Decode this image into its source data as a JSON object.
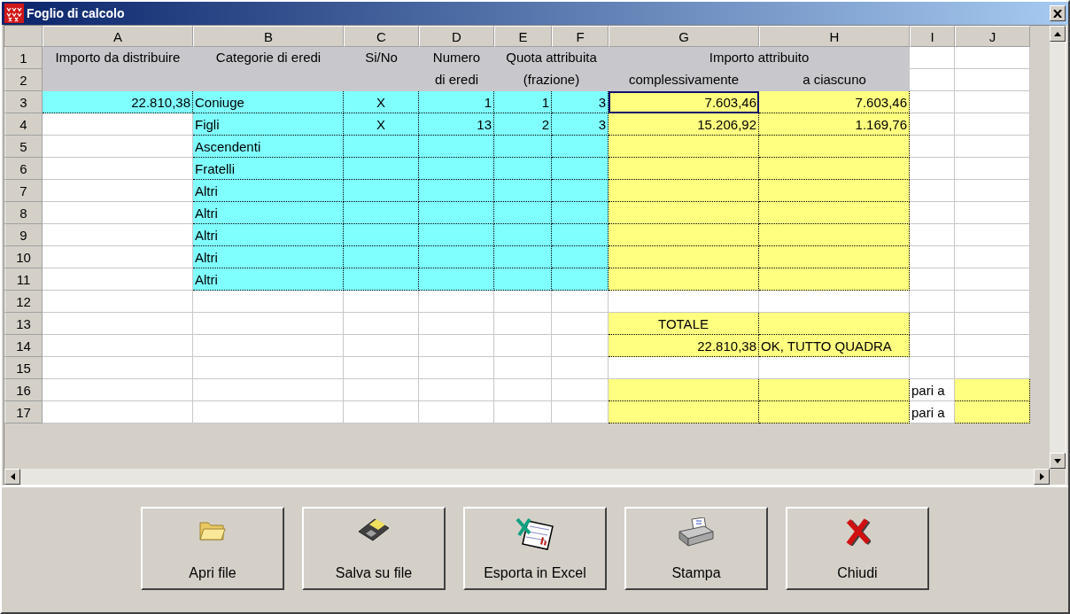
{
  "window": {
    "title": "Foglio di calcolo"
  },
  "sheet": {
    "columns": [
      "A",
      "B",
      "C",
      "D",
      "E",
      "F",
      "G",
      "H",
      "I",
      "J"
    ],
    "rows": [
      {
        "number": "1",
        "cells": [
          {
            "text": "Importo da distribuire",
            "kind": "header",
            "selected": false
          },
          {
            "text": "Categorie di eredi",
            "kind": "header",
            "selected": false
          },
          {
            "text": "Si/No",
            "kind": "header",
            "selected": false
          },
          {
            "text": "Numero",
            "kind": "header",
            "selected": false
          },
          {
            "text": "Quota attribuita",
            "kind": "header",
            "merged": true,
            "selected": false
          },
          {
            "text": "Importo attribuito",
            "kind": "header",
            "merged": true,
            "selected": false
          },
          {
            "kind": "plain",
            "selected": false
          },
          {
            "kind": "plain",
            "selected": false
          }
        ]
      },
      {
        "number": "2",
        "cells": [
          {
            "kind": "header",
            "selected": false
          },
          {
            "kind": "header",
            "selected": false
          },
          {
            "kind": "header",
            "selected": false
          },
          {
            "text": "di eredi",
            "kind": "header",
            "selected": false
          },
          {
            "text": "(frazione)",
            "kind": "header",
            "merged": true,
            "selected": false
          },
          {
            "text": "complessivamente",
            "kind": "header",
            "selected": false
          },
          {
            "text": "a ciascuno",
            "kind": "header",
            "selected": false
          },
          {
            "kind": "plain",
            "selected": false
          },
          {
            "kind": "plain",
            "selected": false
          }
        ]
      },
      {
        "number": "3",
        "cells": [
          {
            "text": "22.810,38",
            "kind": "input-number",
            "selected": false
          },
          {
            "text": "Coniuge",
            "kind": "input-text",
            "selected": false
          },
          {
            "text": "X",
            "kind": "input-mark",
            "selected": false
          },
          {
            "text": "1",
            "kind": "input-number",
            "selected": false
          },
          {
            "text": "1",
            "kind": "input-number",
            "selected": false
          },
          {
            "text": "3",
            "kind": "input-number",
            "selected": false
          },
          {
            "text": "7.603,46",
            "kind": "output-number",
            "selected": true
          },
          {
            "text": "7.603,46",
            "kind": "output-number",
            "selected": false
          },
          {
            "kind": "plain",
            "selected": false
          },
          {
            "kind": "plain",
            "selected": false
          }
        ]
      },
      {
        "number": "4",
        "cells": [
          {
            "kind": "plain",
            "selected": false
          },
          {
            "text": "Figli",
            "kind": "input-text",
            "selected": false
          },
          {
            "text": "X",
            "kind": "input-mark",
            "selected": false
          },
          {
            "text": "13",
            "kind": "input-number",
            "selected": false
          },
          {
            "text": "2",
            "kind": "input-number",
            "selected": false
          },
          {
            "text": "3",
            "kind": "input-number",
            "selected": false
          },
          {
            "text": "15.206,92",
            "kind": "output-number",
            "selected": false
          },
          {
            "text": "1.169,76",
            "kind": "output-number",
            "selected": false
          },
          {
            "kind": "plain",
            "selected": false
          },
          {
            "kind": "plain",
            "selected": false
          }
        ]
      },
      {
        "number": "5",
        "cells": [
          {
            "kind": "plain",
            "selected": false
          },
          {
            "text": "Ascendenti",
            "kind": "input-text",
            "selected": false
          },
          {
            "kind": "input",
            "selected": false
          },
          {
            "kind": "input",
            "selected": false
          },
          {
            "kind": "input",
            "selected": false
          },
          {
            "kind": "input",
            "selected": false
          },
          {
            "kind": "output",
            "selected": false
          },
          {
            "kind": "output",
            "selected": false
          },
          {
            "kind": "plain",
            "selected": false
          },
          {
            "kind": "plain",
            "selected": false
          }
        ]
      },
      {
        "number": "6",
        "cells": [
          {
            "kind": "plain",
            "selected": false
          },
          {
            "text": "Fratelli",
            "kind": "input-text",
            "selected": false
          },
          {
            "kind": "input",
            "selected": false
          },
          {
            "kind": "input",
            "selected": false
          },
          {
            "kind": "input",
            "selected": false
          },
          {
            "kind": "input",
            "selected": false
          },
          {
            "kind": "output",
            "selected": false
          },
          {
            "kind": "output",
            "selected": false
          },
          {
            "kind": "plain",
            "selected": false
          },
          {
            "kind": "plain",
            "selected": false
          }
        ]
      },
      {
        "number": "7",
        "cells": [
          {
            "kind": "plain",
            "selected": false
          },
          {
            "text": "Altri",
            "kind": "input-text",
            "selected": false
          },
          {
            "kind": "input",
            "selected": false
          },
          {
            "kind": "input",
            "selected": false
          },
          {
            "kind": "input",
            "selected": false
          },
          {
            "kind": "input",
            "selected": false
          },
          {
            "kind": "output",
            "selected": false
          },
          {
            "kind": "output",
            "selected": false
          },
          {
            "kind": "plain",
            "selected": false
          },
          {
            "kind": "plain",
            "selected": false
          }
        ]
      },
      {
        "number": "8",
        "cells": [
          {
            "kind": "plain",
            "selected": false
          },
          {
            "text": "Altri",
            "kind": "input-text",
            "selected": false
          },
          {
            "kind": "input",
            "selected": false
          },
          {
            "kind": "input",
            "selected": false
          },
          {
            "kind": "input",
            "selected": false
          },
          {
            "kind": "input",
            "selected": false
          },
          {
            "kind": "output",
            "selected": false
          },
          {
            "kind": "output",
            "selected": false
          },
          {
            "kind": "plain",
            "selected": false
          },
          {
            "kind": "plain",
            "selected": false
          }
        ]
      },
      {
        "number": "9",
        "cells": [
          {
            "kind": "plain",
            "selected": false
          },
          {
            "text": "Altri",
            "kind": "input-text",
            "selected": false
          },
          {
            "kind": "input",
            "selected": false
          },
          {
            "kind": "input",
            "selected": false
          },
          {
            "kind": "input",
            "selected": false
          },
          {
            "kind": "input",
            "selected": false
          },
          {
            "kind": "output",
            "selected": false
          },
          {
            "kind": "output",
            "selected": false
          },
          {
            "kind": "plain",
            "selected": false
          },
          {
            "kind": "plain",
            "selected": false
          }
        ]
      },
      {
        "number": "10",
        "cells": [
          {
            "kind": "plain",
            "selected": false
          },
          {
            "text": "Altri",
            "kind": "input-text",
            "selected": false
          },
          {
            "kind": "input",
            "selected": false
          },
          {
            "kind": "input",
            "selected": false
          },
          {
            "kind": "input",
            "selected": false
          },
          {
            "kind": "input",
            "selected": false
          },
          {
            "kind": "output",
            "selected": false
          },
          {
            "kind": "output",
            "selected": false
          },
          {
            "kind": "plain",
            "selected": false
          },
          {
            "kind": "plain",
            "selected": false
          }
        ]
      },
      {
        "number": "11",
        "cells": [
          {
            "kind": "plain",
            "selected": false
          },
          {
            "text": "Altri",
            "kind": "input-text",
            "selected": false
          },
          {
            "kind": "input",
            "selected": false
          },
          {
            "kind": "input",
            "selected": false
          },
          {
            "kind": "input",
            "selected": false
          },
          {
            "kind": "input",
            "selected": false
          },
          {
            "kind": "output",
            "selected": false
          },
          {
            "kind": "output",
            "selected": false
          },
          {
            "kind": "plain",
            "selected": false
          },
          {
            "kind": "plain",
            "selected": false
          }
        ]
      },
      {
        "number": "12",
        "cells": [
          {
            "kind": "plain",
            "selected": false
          },
          {
            "kind": "plain",
            "selected": false
          },
          {
            "kind": "plain",
            "selected": false
          },
          {
            "kind": "plain",
            "selected": false
          },
          {
            "kind": "plain",
            "selected": false
          },
          {
            "kind": "plain",
            "selected": false
          },
          {
            "kind": "plain",
            "selected": false
          },
          {
            "kind": "plain",
            "selected": false
          },
          {
            "kind": "plain",
            "selected": false
          },
          {
            "kind": "plain",
            "selected": false
          }
        ]
      },
      {
        "number": "13",
        "cells": [
          {
            "kind": "plain",
            "selected": false
          },
          {
            "kind": "plain",
            "selected": false
          },
          {
            "kind": "plain",
            "selected": false
          },
          {
            "kind": "plain",
            "selected": false
          },
          {
            "kind": "plain",
            "selected": false
          },
          {
            "kind": "plain",
            "selected": false
          },
          {
            "text": "TOTALE",
            "kind": "output-title",
            "selected": false
          },
          {
            "kind": "output",
            "selected": false
          },
          {
            "kind": "plain",
            "selected": false
          },
          {
            "kind": "plain",
            "selected": false
          }
        ]
      },
      {
        "number": "14",
        "cells": [
          {
            "kind": "plain",
            "selected": false
          },
          {
            "kind": "plain",
            "selected": false
          },
          {
            "kind": "plain",
            "selected": false
          },
          {
            "kind": "plain",
            "selected": false
          },
          {
            "kind": "plain",
            "selected": false
          },
          {
            "kind": "plain",
            "selected": false
          },
          {
            "text": "22.810,38",
            "kind": "output-number",
            "selected": false
          },
          {
            "text": "OK, TUTTO QUADRA",
            "kind": "output-text",
            "selected": false
          },
          {
            "kind": "plain",
            "selected": false
          },
          {
            "kind": "plain",
            "selected": false
          }
        ]
      },
      {
        "number": "15",
        "cells": [
          {
            "kind": "plain",
            "selected": false
          },
          {
            "kind": "plain",
            "selected": false
          },
          {
            "kind": "plain",
            "selected": false
          },
          {
            "kind": "plain",
            "selected": false
          },
          {
            "kind": "plain",
            "selected": false
          },
          {
            "kind": "plain",
            "selected": false
          },
          {
            "kind": "plain",
            "selected": false
          },
          {
            "kind": "plain",
            "selected": false
          },
          {
            "kind": "plain",
            "selected": false
          },
          {
            "kind": "plain",
            "selected": false
          }
        ]
      },
      {
        "number": "16",
        "cells": [
          {
            "kind": "plain",
            "selected": false
          },
          {
            "kind": "plain",
            "selected": false
          },
          {
            "kind": "plain",
            "selected": false
          },
          {
            "kind": "plain",
            "selected": false
          },
          {
            "kind": "plain",
            "selected": false
          },
          {
            "kind": "plain",
            "selected": false
          },
          {
            "kind": "output",
            "selected": false
          },
          {
            "kind": "output",
            "selected": false
          },
          {
            "text": "pari a",
            "kind": "plain-text",
            "selected": false
          },
          {
            "kind": "output",
            "selected": false
          }
        ]
      },
      {
        "number": "17",
        "cells": [
          {
            "kind": "plain",
            "selected": false
          },
          {
            "kind": "plain",
            "selected": false
          },
          {
            "kind": "plain",
            "selected": false
          },
          {
            "kind": "plain",
            "selected": false
          },
          {
            "kind": "plain",
            "selected": false
          },
          {
            "kind": "plain",
            "selected": false
          },
          {
            "kind": "output",
            "selected": false
          },
          {
            "kind": "output",
            "selected": false
          },
          {
            "text": "pari a",
            "kind": "plain-text",
            "selected": false
          },
          {
            "kind": "output",
            "selected": false
          }
        ]
      }
    ]
  },
  "buttons": [
    {
      "label": "Apri file",
      "kind": "folder"
    },
    {
      "label": "Salva su file",
      "kind": "floppy"
    },
    {
      "label": "Esporta in Excel",
      "kind": "spreadsheet"
    },
    {
      "label": "Stampa",
      "kind": "printer"
    },
    {
      "label": "Chiudi",
      "kind": "cross"
    }
  ]
}
